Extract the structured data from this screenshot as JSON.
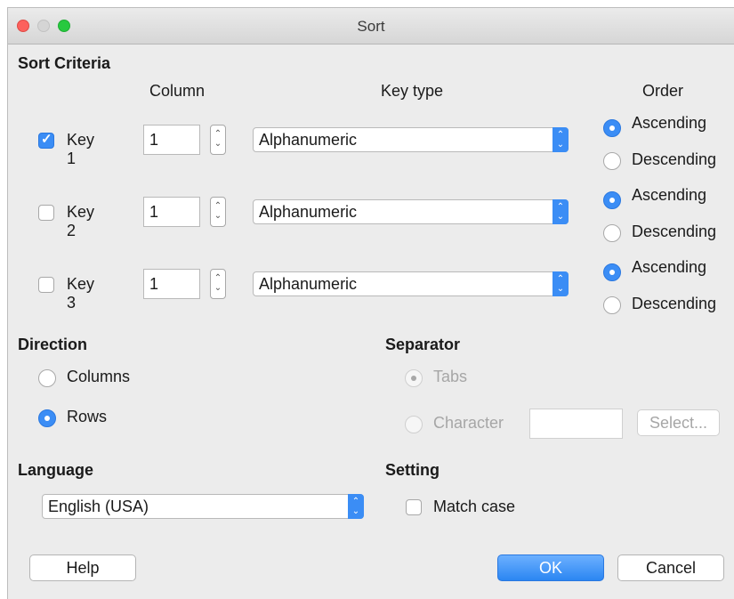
{
  "window": {
    "title": "Sort",
    "traffic_lights": [
      "#fc615d",
      "#d5d5d5",
      "#27c93f"
    ]
  },
  "sort_criteria": {
    "heading": "Sort Criteria",
    "col_headers": {
      "column": "Column",
      "key_type": "Key type",
      "order": "Order"
    },
    "keys": [
      {
        "label": "Key 1",
        "checked": true,
        "column": "1",
        "key_type": "Alphanumeric",
        "ascending": "Ascending",
        "descending": "Descending",
        "order": "ascending"
      },
      {
        "label": "Key 2",
        "checked": false,
        "column": "1",
        "key_type": "Alphanumeric",
        "ascending": "Ascending",
        "descending": "Descending",
        "order": "ascending"
      },
      {
        "label": "Key 3",
        "checked": false,
        "column": "1",
        "key_type": "Alphanumeric",
        "ascending": "Ascending",
        "descending": "Descending",
        "order": "ascending"
      }
    ]
  },
  "direction": {
    "heading": "Direction",
    "columns": "Columns",
    "rows": "Rows",
    "selected": "rows"
  },
  "separator": {
    "heading": "Separator",
    "tabs": "Tabs",
    "character": "Character",
    "character_value": "",
    "select_button": "Select...",
    "selected": "tabs",
    "enabled": false
  },
  "language": {
    "heading": "Language",
    "value": "English (USA)"
  },
  "setting": {
    "heading": "Setting",
    "match_case": "Match case",
    "match_case_checked": false
  },
  "buttons": {
    "help": "Help",
    "ok": "OK",
    "cancel": "Cancel"
  },
  "colors": {
    "accent": "#3b8df5",
    "dialog_bg": "#ececec"
  }
}
